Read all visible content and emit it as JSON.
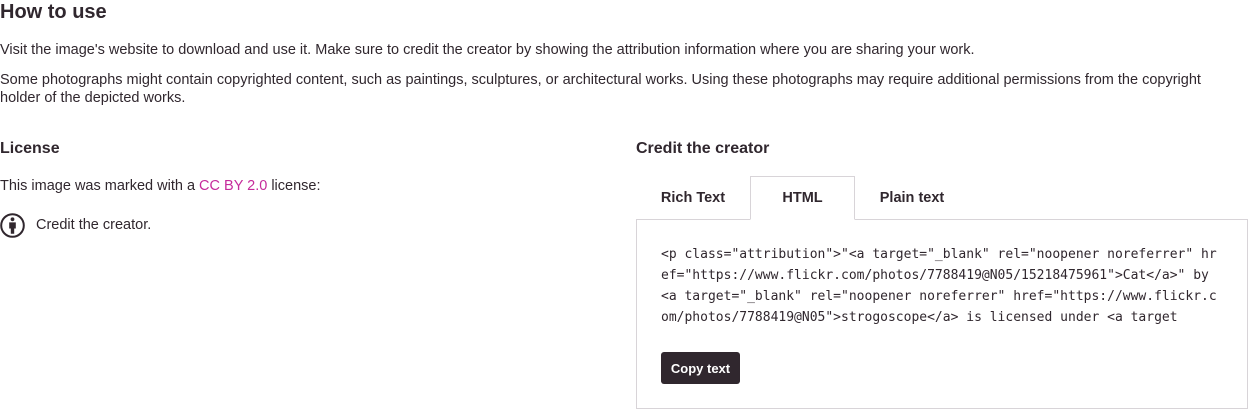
{
  "how_to_use": {
    "title": "How to use",
    "paragraph_1": "Visit the image's website to download and use it. Make sure to credit the creator by showing the attribution information where you are sharing your work.",
    "paragraph_2": "Some photographs might contain copyrighted content, such as paintings, sculptures, or architectural works. Using these photographs may require additional permissions from the copyright holder of the depicted works."
  },
  "license": {
    "title": "License",
    "prefix": "This image was marked with a ",
    "link_text": "CC BY 2.0",
    "suffix": " license:",
    "item_icon": "cc-by-icon",
    "item_label": "Credit the creator.",
    "link_color": "#c52b9b"
  },
  "credit": {
    "title": "Credit the creator",
    "tabs": [
      {
        "label": "Rich Text",
        "active": false
      },
      {
        "label": "HTML",
        "active": true
      },
      {
        "label": "Plain text",
        "active": false
      }
    ],
    "code_text": "<p class=\"attribution\">\"<a target=\"_blank\" rel=\"noopener noreferrer\" href=\"https://www.flickr.com/photos/7788419@N05/15218475961\">Cat</a>\" by <a target=\"_blank\" rel=\"noopener noreferrer\" href=\"https://www.flickr.com/photos/7788419@N05\">strogoscope</a> is licensed under <a target",
    "copy_label": "Copy text"
  },
  "colors": {
    "text": "#30272e",
    "border": "#d8d4d8",
    "button_bg": "#30272e"
  }
}
